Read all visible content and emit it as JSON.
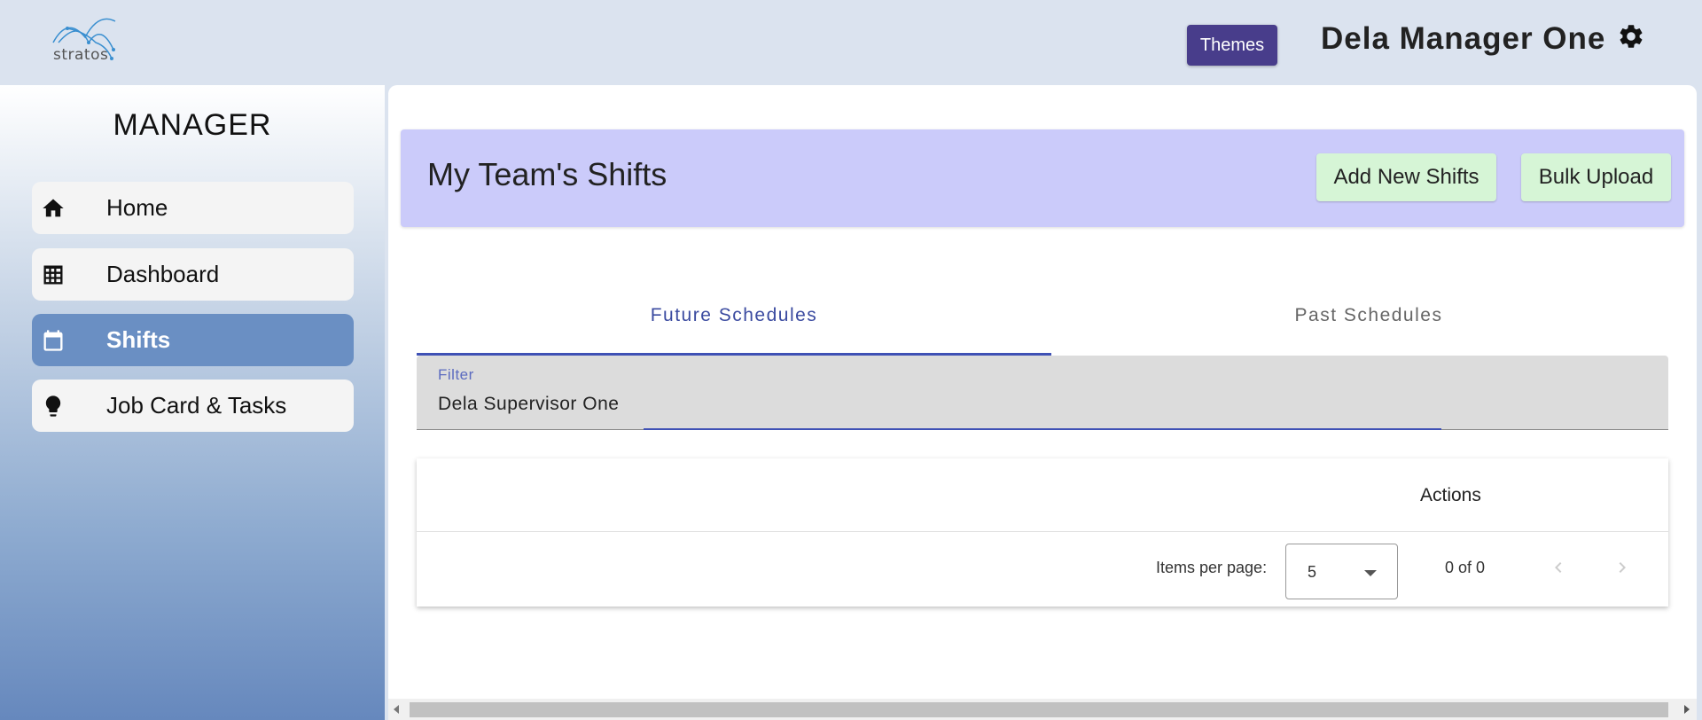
{
  "header": {
    "logo_text": "stratos",
    "themes_label": "Themes",
    "user_name": "Dela Manager One"
  },
  "sidebar": {
    "title": "MANAGER",
    "items": [
      {
        "label": "Home",
        "icon": "home-icon",
        "active": false
      },
      {
        "label": "Dashboard",
        "icon": "grid-icon",
        "active": false
      },
      {
        "label": "Shifts",
        "icon": "calendar-icon",
        "active": true
      },
      {
        "label": "Job Card & Tasks",
        "icon": "lightbulb-icon",
        "active": false
      }
    ]
  },
  "main": {
    "title": "My Team's Shifts",
    "add_new_label": "Add New Shifts",
    "bulk_upload_label": "Bulk Upload",
    "tabs": [
      {
        "label": "Future Schedules",
        "active": true
      },
      {
        "label": "Past Schedules",
        "active": false
      }
    ],
    "filter": {
      "label": "Filter",
      "value": "Dela Supervisor One"
    },
    "table": {
      "columns": [
        "Actions"
      ],
      "rows": []
    },
    "paginator": {
      "items_per_page_label": "Items per page:",
      "items_per_page_value": "5",
      "range_label": "0 of 0"
    }
  },
  "colors": {
    "themes_button": "#483d8b",
    "header_card": "#cbcbfa",
    "action_buttons": "#d6f5d6",
    "active_nav": "#6a8fc3",
    "tab_accent": "#3f51b5"
  }
}
